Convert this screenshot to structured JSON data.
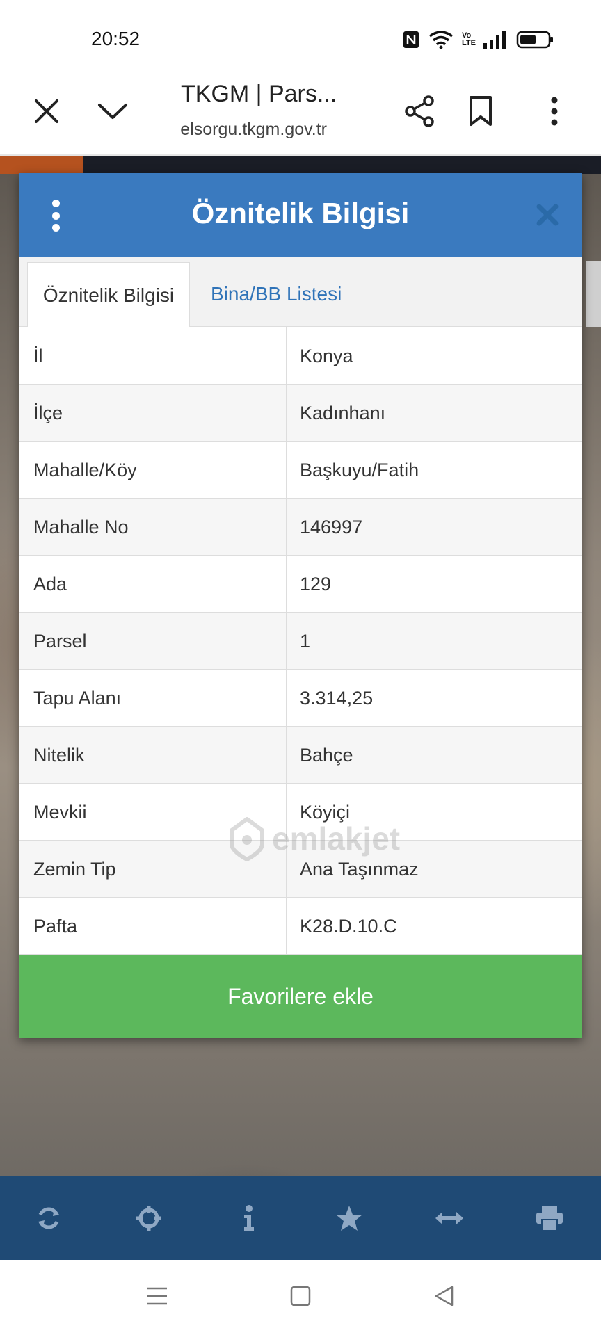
{
  "status_bar": {
    "time": "20:52",
    "icons": [
      "nfc-icon",
      "wifi-icon",
      "volte-icon",
      "signal-icon",
      "battery-icon"
    ],
    "volte_label": "Vo LTE"
  },
  "browser": {
    "title": "TKGM | Pars...",
    "url": "parselsorgu.tkgm.gov.tr",
    "icons": [
      "close-icon",
      "chevron-down-icon",
      "share-icon",
      "bookmark-icon",
      "more-vertical-icon"
    ]
  },
  "dialog": {
    "title": "Öznitelik Bilgisi",
    "tabs": [
      {
        "label": "Öznitelik Bilgisi",
        "active": true
      },
      {
        "label": "Bina/BB Listesi",
        "active": false
      }
    ],
    "rows": [
      {
        "key": "İl",
        "value": "Konya"
      },
      {
        "key": "İlçe",
        "value": "Kadınhanı"
      },
      {
        "key": "Mahalle/Köy",
        "value": "Başkuyu/Fatih"
      },
      {
        "key": "Mahalle No",
        "value": "146997"
      },
      {
        "key": "Ada",
        "value": "129"
      },
      {
        "key": "Parsel",
        "value": "1"
      },
      {
        "key": "Tapu Alanı",
        "value": "3.314,25"
      },
      {
        "key": "Nitelik",
        "value": "Bahçe"
      },
      {
        "key": "Mevkii",
        "value": "Köyiçi"
      },
      {
        "key": "Zemin Tip",
        "value": "Ana Taşınmaz"
      },
      {
        "key": "Pafta",
        "value": "K28.D.10.C"
      }
    ],
    "favorite_button": "Favorilere ekle"
  },
  "watermark": "emlakjet",
  "map_toolbar": {
    "icons": [
      "refresh-icon",
      "crosshair-icon",
      "info-icon",
      "star-icon",
      "measure-icon",
      "print-icon"
    ]
  },
  "nav_bar": {
    "icons": [
      "menu-icon",
      "home-icon",
      "back-icon"
    ]
  },
  "colors": {
    "header_blue": "#3a7abf",
    "tab_link_blue": "#2f73b8",
    "button_green": "#5cb85c",
    "map_toolbar_blue": "#1f4a75"
  }
}
